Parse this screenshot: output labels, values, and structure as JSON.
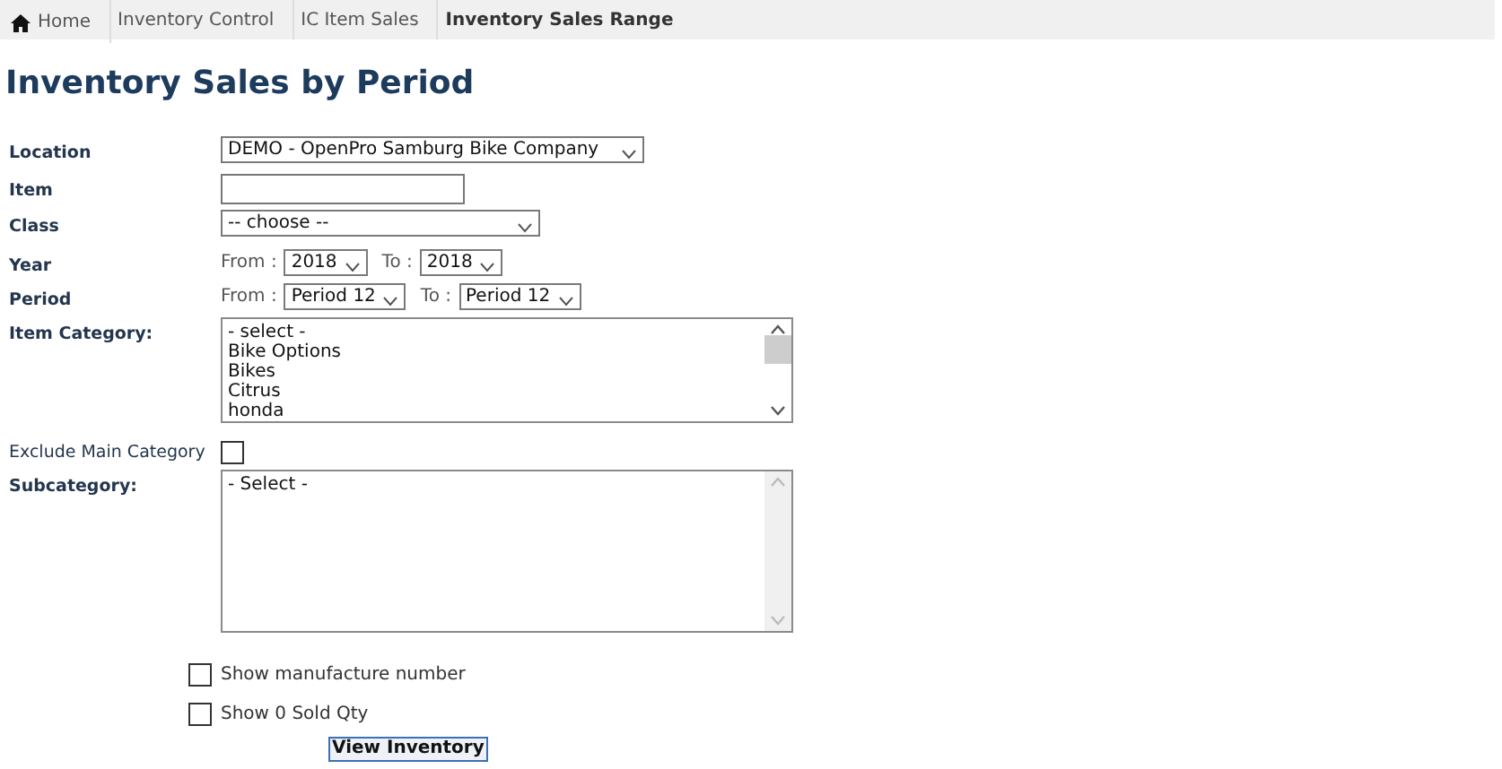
{
  "breadcrumb": [
    {
      "kind": "home",
      "label": "Home"
    },
    {
      "kind": "link",
      "label": "Inventory Control"
    },
    {
      "kind": "link",
      "label": "IC Item Sales"
    },
    {
      "kind": "current",
      "label": "Inventory Sales Range"
    }
  ],
  "title": "Inventory Sales by Period",
  "fields": [
    {
      "kind": "select",
      "label": "Location",
      "value": "DEMO - OpenPro Samburg Bike Company"
    },
    {
      "kind": "input",
      "label": "Item"
    },
    {
      "kind": "select",
      "label": "Class",
      "value": "-- choose --"
    },
    {
      "kind": "range",
      "label": "Year",
      "from_label": "From :",
      "from": "2018",
      "to_label": "To :",
      "to": "2018"
    },
    {
      "kind": "range",
      "label": "Period",
      "from_label": "From :",
      "from": "Period 12",
      "to_label": "To :",
      "to": "Period 12"
    },
    {
      "kind": "listbox",
      "label": "Item Category:",
      "options": [
        "- select -",
        "Bike Options",
        "Bikes",
        "Citrus",
        "honda"
      ],
      "disabled": false
    },
    {
      "kind": "checkbox",
      "label": "Exclude Main Category",
      "checked": false
    },
    {
      "kind": "listbox",
      "label": "Subcategory:",
      "options": [
        "- Select -"
      ],
      "disabled": true
    }
  ],
  "options": [
    {
      "label": "Show manufacture number",
      "checked": false
    },
    {
      "label": "Show 0 Sold Qty",
      "checked": false
    }
  ],
  "submit": "View Inventory"
}
